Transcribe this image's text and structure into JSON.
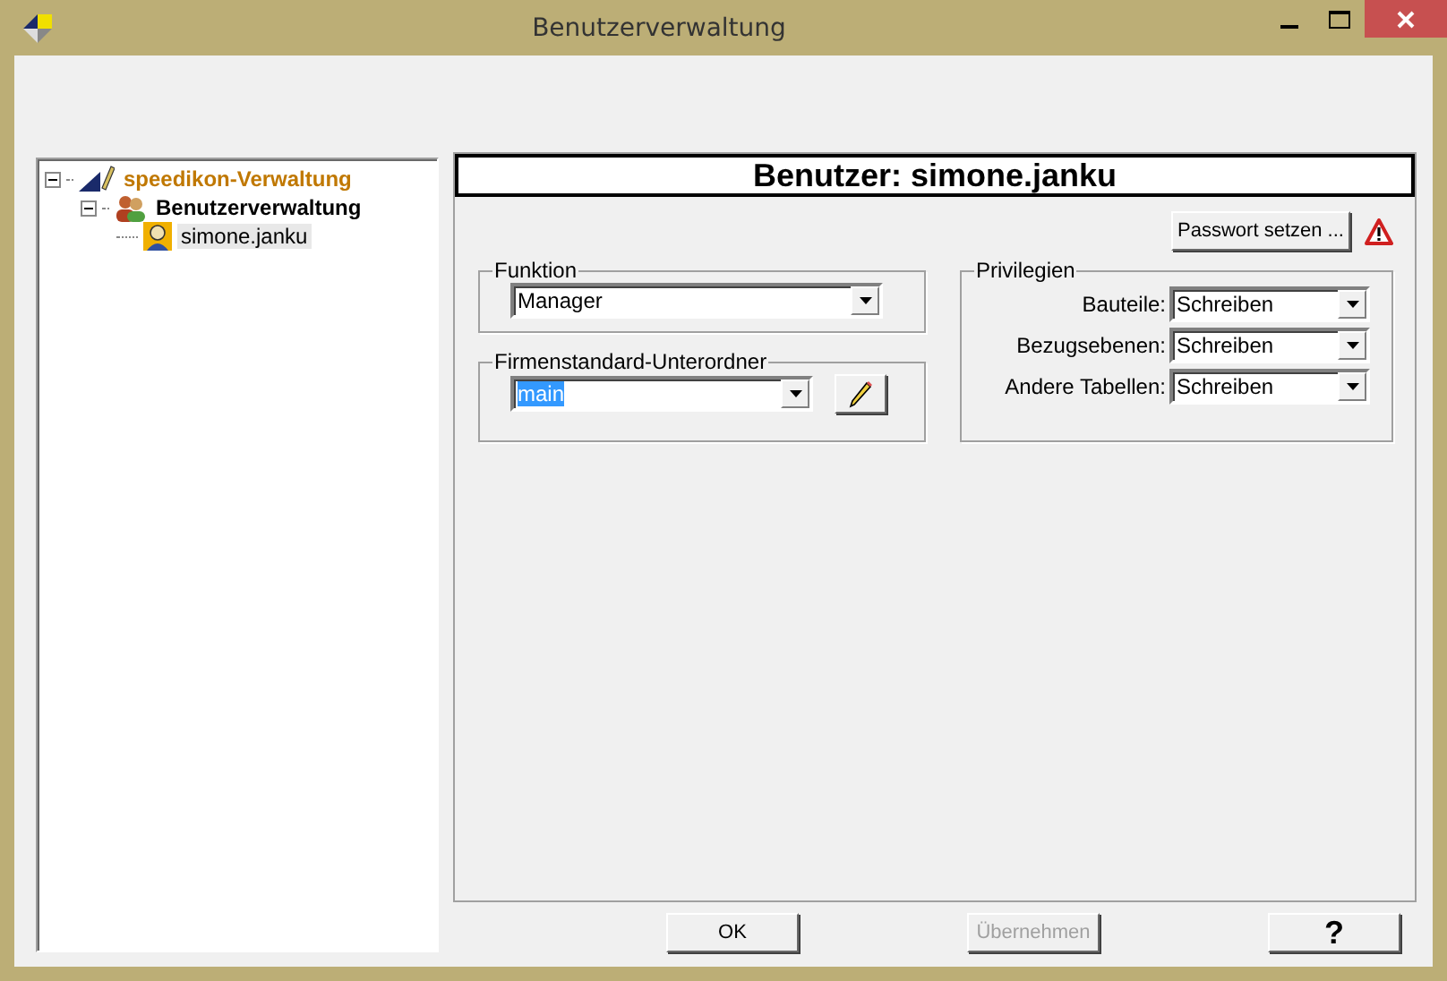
{
  "window": {
    "title": "Benutzerverwaltung"
  },
  "tree": [
    {
      "label": "speedikon-Verwaltung",
      "kind": "root",
      "expanded": true,
      "selected": false,
      "children": [
        {
          "label": "Benutzerverwaltung",
          "kind": "group",
          "expanded": true,
          "selected": false,
          "children": [
            {
              "label": "simone.janku",
              "kind": "user",
              "selected": true
            }
          ]
        }
      ]
    }
  ],
  "header": "Benutzer: simone.janku",
  "password_button": "Passwort setzen ...",
  "funktion": {
    "legend": "Funktion",
    "value": "Manager"
  },
  "subfolder": {
    "legend": "Firmenstandard-Unterordner",
    "value": "main",
    "text_selected": true
  },
  "privileges": {
    "legend": "Privilegien",
    "rows": [
      {
        "label": "Bauteile:",
        "value": "Schreiben"
      },
      {
        "label": "Bezugsebenen:",
        "value": "Schreiben"
      },
      {
        "label": "Andere Tabellen:",
        "value": "Schreiben"
      }
    ]
  },
  "buttons": [
    {
      "label": "OK",
      "kind": "ok",
      "disabled": false
    },
    {
      "label": "Übernehmen",
      "kind": "apply",
      "disabled": true
    },
    {
      "label": "?",
      "kind": "help",
      "disabled": false
    }
  ]
}
